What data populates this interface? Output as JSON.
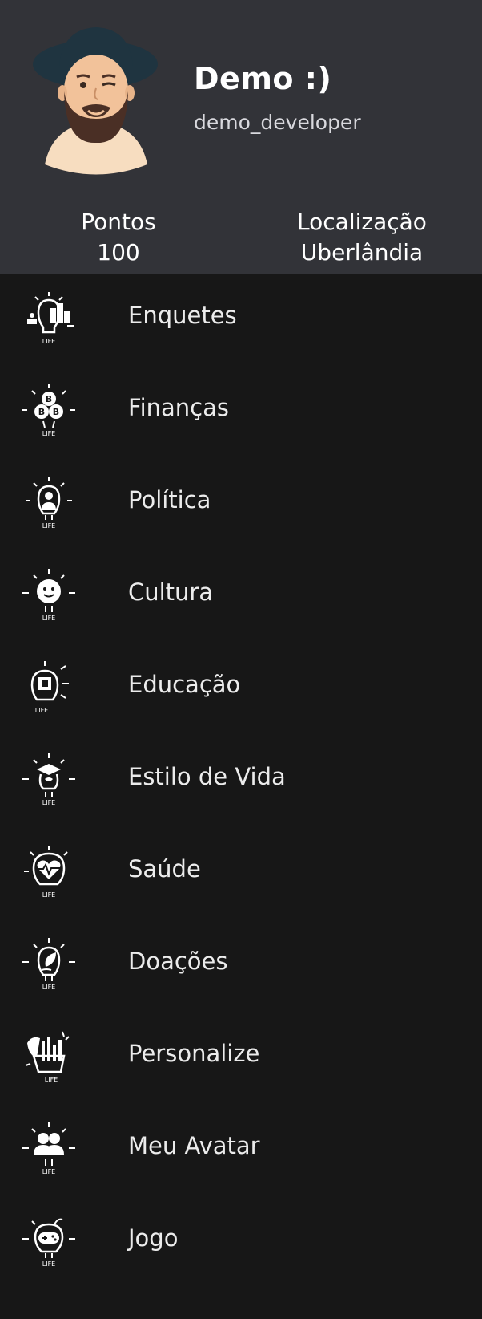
{
  "profile": {
    "name": "Demo :)",
    "username": "demo_developer",
    "points_label": "Pontos",
    "points_value": "100",
    "location_label": "Localização",
    "location_value": "Uberlândia"
  },
  "menu": [
    {
      "label": "Enquetes",
      "icon": "bulb-ranking-icon"
    },
    {
      "label": "Finanças",
      "icon": "bulb-bitcoin-icon"
    },
    {
      "label": "Política",
      "icon": "bulb-politician-icon"
    },
    {
      "label": "Cultura",
      "icon": "bulb-theater-masks-icon"
    },
    {
      "label": "Educação",
      "icon": "bulb-chip-icon"
    },
    {
      "label": "Estilo de Vida",
      "icon": "bulb-graduation-brain-icon"
    },
    {
      "label": "Saúde",
      "icon": "bulb-heart-pulse-icon"
    },
    {
      "label": "Doações",
      "icon": "bulb-leaf-hand-icon"
    },
    {
      "label": "Personalize",
      "icon": "bulb-art-tools-icon"
    },
    {
      "label": "Meu Avatar",
      "icon": "bulb-users-icon"
    },
    {
      "label": "Jogo",
      "icon": "bulb-gamepad-icon"
    }
  ],
  "icon_caption": "LIFE",
  "colors": {
    "header_bg": "#323338",
    "page_bg": "#171717",
    "text": "#ffffff",
    "subtext": "#d9d9de"
  }
}
